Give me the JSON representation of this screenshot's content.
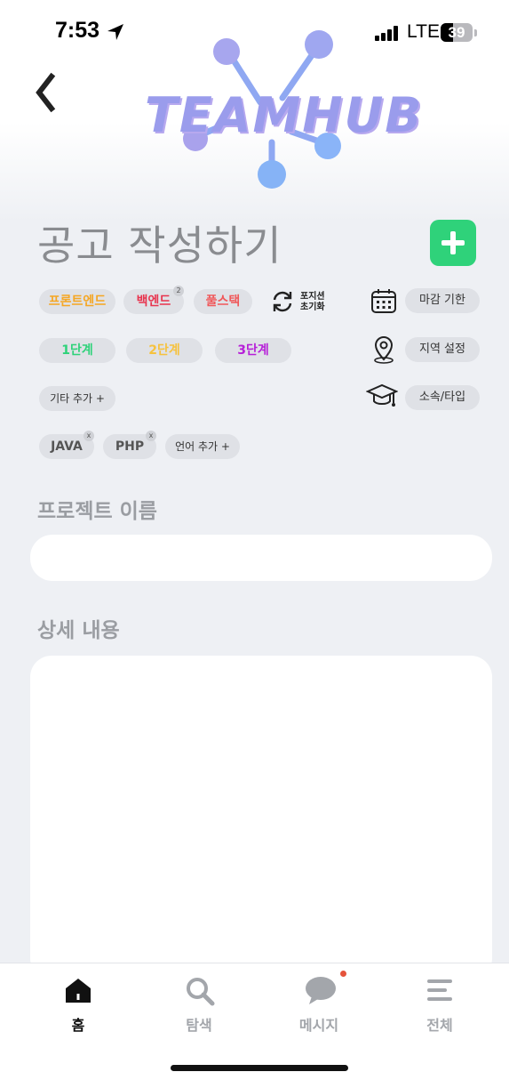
{
  "status_bar": {
    "time": "7:53",
    "network": "LTE",
    "battery": "39",
    "battery_level": 0.39
  },
  "header": {
    "logo_text": "TEAMHUB",
    "colors": {
      "logo_primary": "#9a9cec",
      "logo_secondary": "#8ab4f8"
    }
  },
  "title": "공고 작성하기",
  "add_button_color": "#2fd27a",
  "positions": [
    {
      "label": "프론트엔드",
      "color": "#f5a623"
    },
    {
      "label": "백엔드",
      "color": "#e8344e",
      "badge": "2"
    },
    {
      "label": "풀스택",
      "color": "#f0585a"
    }
  ],
  "reset_label": [
    "포지션",
    "초기화"
  ],
  "levels": [
    {
      "label": "1단계",
      "color": "#2fd27a"
    },
    {
      "label": "2단계",
      "color": "#f6c23e"
    },
    {
      "label": "3단계",
      "color": "#b620d8"
    }
  ],
  "other_add": "기타 추가 +",
  "languages": [
    {
      "label": "JAVA",
      "remove": "x"
    },
    {
      "label": "PHP",
      "remove": "x"
    }
  ],
  "language_add": "언어 추가 +",
  "side_options": [
    {
      "label": "마감 기한",
      "icon": "calendar-icon"
    },
    {
      "label": "지역 설정",
      "icon": "location-pin-icon"
    },
    {
      "label": "소속/타입",
      "icon": "graduation-cap-icon"
    }
  ],
  "sections": {
    "project_name": "프로젝트 이름",
    "details": "상세 내용"
  },
  "tabs": [
    {
      "label": "홈",
      "icon": "home-icon",
      "active": true
    },
    {
      "label": "탐색",
      "icon": "search-icon",
      "active": false
    },
    {
      "label": "메시지",
      "icon": "chat-bubble-icon",
      "active": false
    },
    {
      "label": "전체",
      "icon": "menu-icon",
      "active": false
    }
  ]
}
